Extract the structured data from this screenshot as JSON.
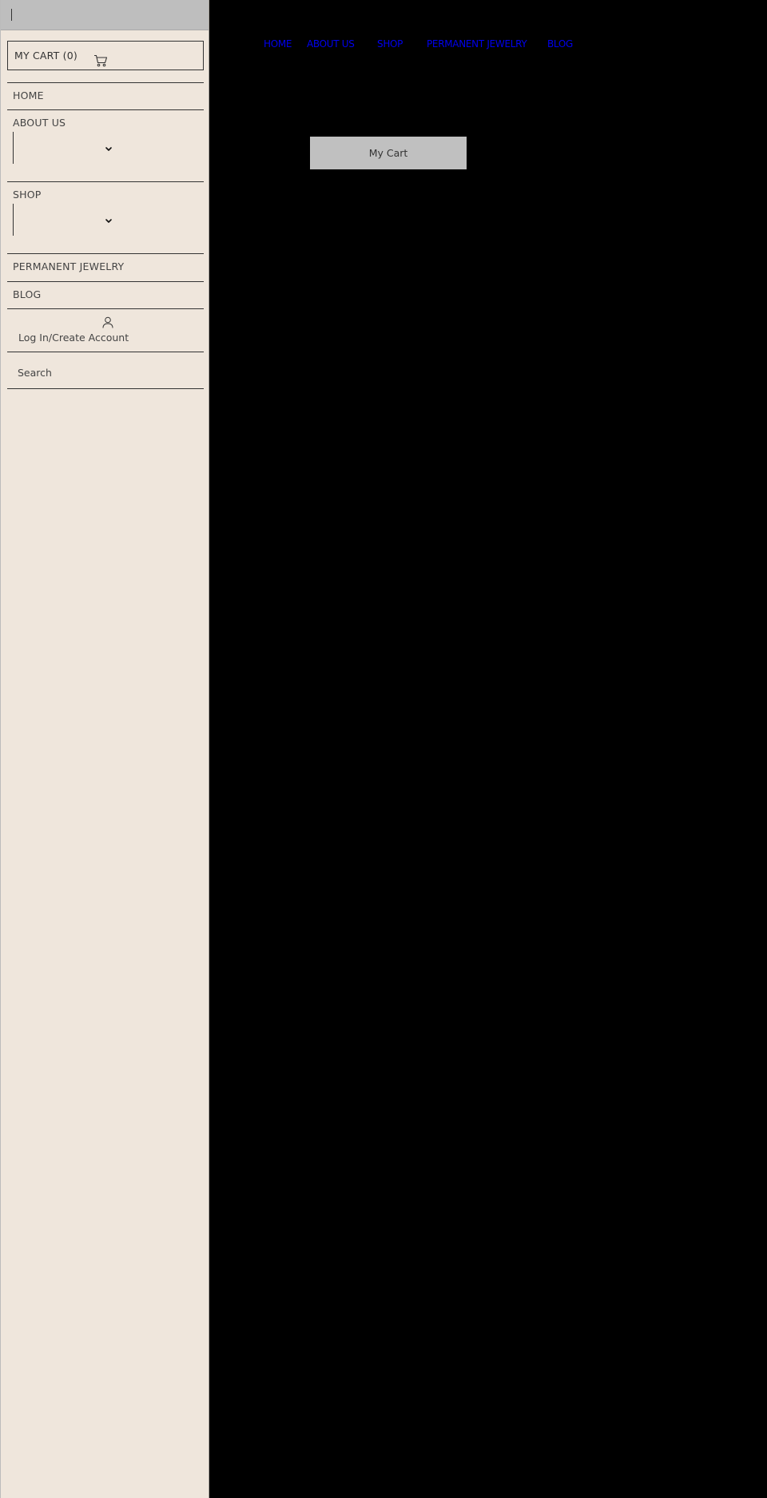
{
  "sidebar": {
    "cart_label": "MY CART (0)",
    "nav": {
      "home": "HOME",
      "about": "ABOUT US",
      "shop": "SHOP",
      "permanent": "PERMANENT JEWELRY",
      "blog": "BLOG"
    },
    "login_label": "Log In/Create Account",
    "search_placeholder": "Search"
  },
  "top_nav": {
    "home": "HOME",
    "about": "ABOUT US",
    "shop": "SHOP",
    "permanent": "PERMANENT JEWELRY",
    "blog": "BLOG"
  },
  "main": {
    "cart_button_label": "My Cart"
  },
  "icons": {
    "cart": "cart-icon",
    "chevron": "chevron-down-icon",
    "person": "person-icon"
  },
  "colors": {
    "sidebar_bg": "#efe6dc",
    "sidebar_header": "#bebebe",
    "page_bg": "#000000",
    "link": "#0000ee",
    "button_bg": "#c0c0c0"
  }
}
